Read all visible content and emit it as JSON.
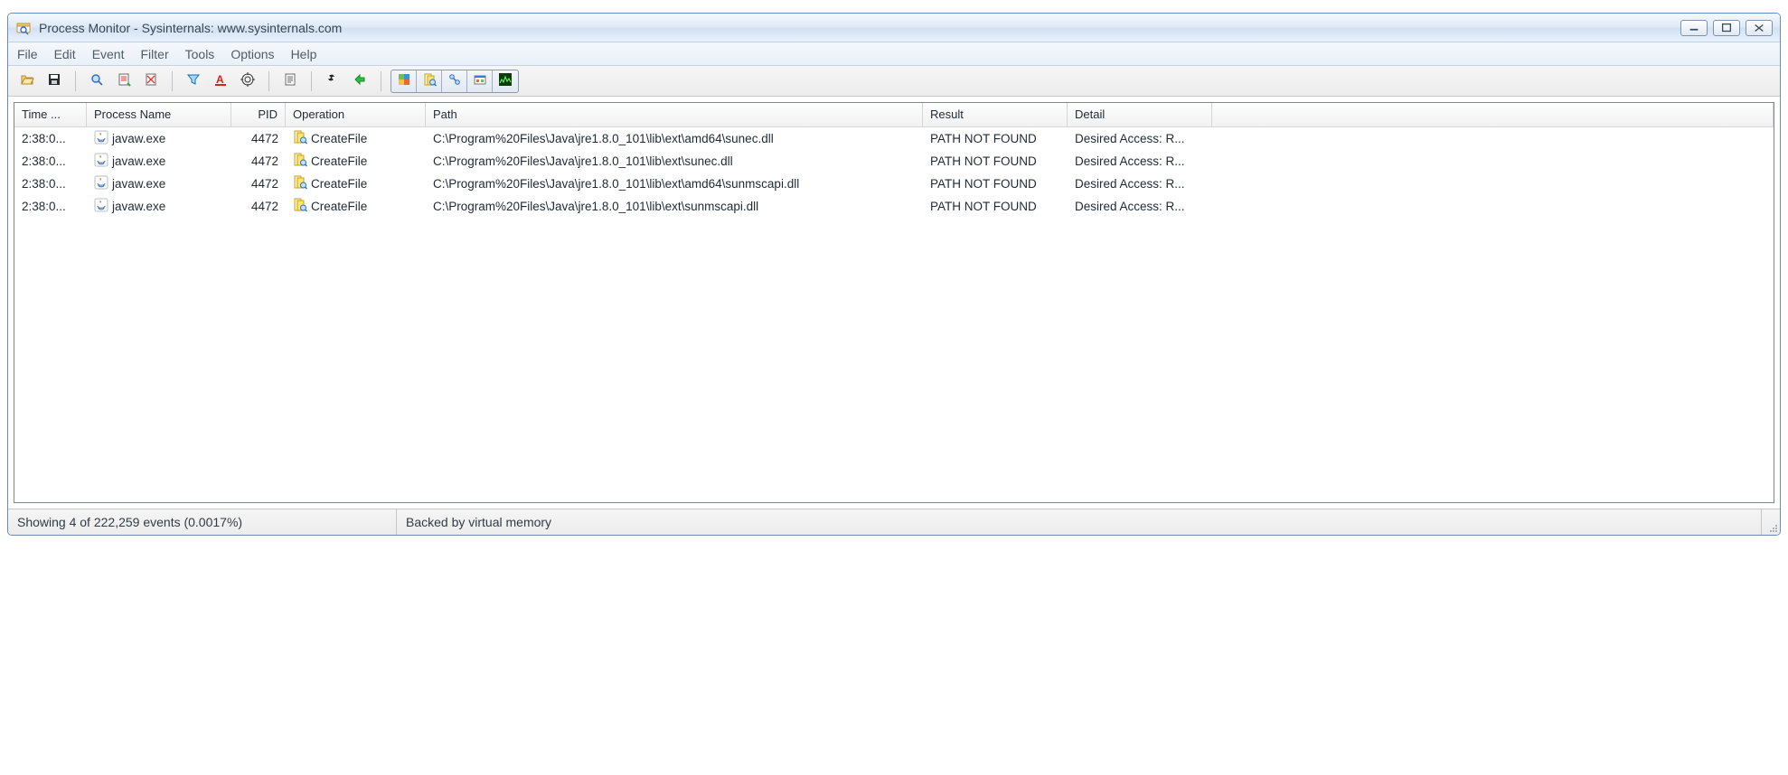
{
  "window": {
    "title": "Process Monitor - Sysinternals: www.sysinternals.com"
  },
  "menu": [
    "File",
    "Edit",
    "Event",
    "Filter",
    "Tools",
    "Options",
    "Help"
  ],
  "columns": [
    "Time ...",
    "Process Name",
    "PID",
    "Operation",
    "Path",
    "Result",
    "Detail",
    ""
  ],
  "rows": [
    {
      "time": "2:38:0...",
      "process": "javaw.exe",
      "pid": "4472",
      "operation": "CreateFile",
      "path": "C:\\Program%20Files\\Java\\jre1.8.0_101\\lib\\ext\\amd64\\sunec.dll",
      "result": "PATH NOT FOUND",
      "detail": "Desired Access: R..."
    },
    {
      "time": "2:38:0...",
      "process": "javaw.exe",
      "pid": "4472",
      "operation": "CreateFile",
      "path": "C:\\Program%20Files\\Java\\jre1.8.0_101\\lib\\ext\\sunec.dll",
      "result": "PATH NOT FOUND",
      "detail": "Desired Access: R..."
    },
    {
      "time": "2:38:0...",
      "process": "javaw.exe",
      "pid": "4472",
      "operation": "CreateFile",
      "path": "C:\\Program%20Files\\Java\\jre1.8.0_101\\lib\\ext\\amd64\\sunmscapi.dll",
      "result": "PATH NOT FOUND",
      "detail": "Desired Access: R..."
    },
    {
      "time": "2:38:0...",
      "process": "javaw.exe",
      "pid": "4472",
      "operation": "CreateFile",
      "path": "C:\\Program%20Files\\Java\\jre1.8.0_101\\lib\\ext\\sunmscapi.dll",
      "result": "PATH NOT FOUND",
      "detail": "Desired Access: R..."
    }
  ],
  "status": {
    "left": "Showing 4 of 222,259 events (0.0017%)",
    "right": "Backed by virtual memory"
  },
  "toolbar": {
    "std": [
      "open",
      "save"
    ],
    "capture": [
      "capture",
      "autoscroll",
      "clear"
    ],
    "filter": [
      "filter",
      "highlight",
      "include"
    ],
    "events": [
      "event-props"
    ],
    "find": [
      "find",
      "jump"
    ],
    "activity": [
      "registry",
      "filesystem",
      "network",
      "process",
      "profiling"
    ]
  }
}
